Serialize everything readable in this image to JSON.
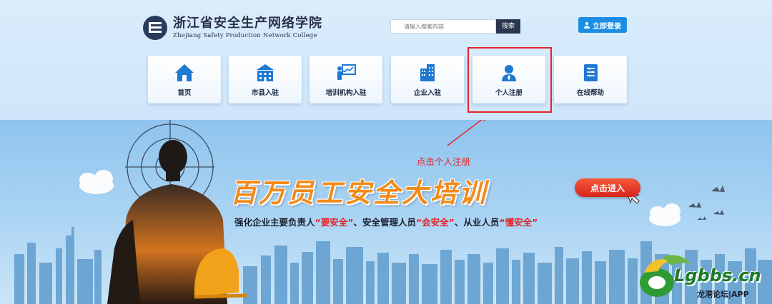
{
  "header": {
    "logo": {
      "title_cn": "浙江省安全生产网络学院",
      "title_en": "Zhejiang Safety Production Network College"
    },
    "search": {
      "placeholder": "请输入搜索内容",
      "button_label": "搜索"
    },
    "login_button": {
      "label": "立即登录",
      "icon": "user-icon"
    }
  },
  "nav": {
    "items": [
      {
        "label": "首页",
        "icon": "home-icon"
      },
      {
        "label": "市县入驻",
        "icon": "city-building-icon"
      },
      {
        "label": "培训机构入驻",
        "icon": "training-presentation-icon"
      },
      {
        "label": "企业入驻",
        "icon": "office-building-icon"
      },
      {
        "label": "个人注册",
        "icon": "person-icon"
      },
      {
        "label": "在线帮助",
        "icon": "help-document-icon"
      }
    ],
    "highlighted_index": 4,
    "highlight_color": "#e5232b"
  },
  "banner": {
    "annotation": "点击个人注册",
    "headline": "百万员工安全大培训",
    "cta": "点击进入",
    "slogan": {
      "p1": "强化企业主要负责人",
      "q1": "“要安全”",
      "p2": "、安全管理人员",
      "q2": "“会安全”",
      "p3": "、从业人员",
      "q3": "“懂安全”"
    }
  },
  "watermark": {
    "text": "Lgbbs.cn",
    "sub": "龙港论坛|APP"
  },
  "colors": {
    "accent": "#1b8ee3",
    "headline": "#f28a1a",
    "emphasis": "#e5232b"
  }
}
